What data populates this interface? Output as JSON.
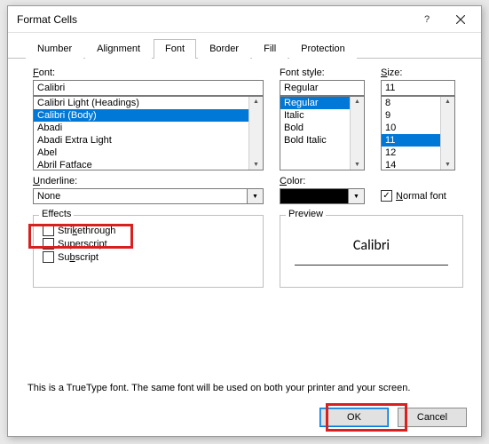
{
  "title": "Format Cells",
  "tabs": [
    "Number",
    "Alignment",
    "Font",
    "Border",
    "Fill",
    "Protection"
  ],
  "active_tab": "Font",
  "font": {
    "label": "Font:",
    "value": "Calibri",
    "items": [
      "Calibri Light (Headings)",
      "Calibri (Body)",
      "Abadi",
      "Abadi Extra Light",
      "Abel",
      "Abril Fatface"
    ],
    "selected": "Calibri (Body)"
  },
  "font_style": {
    "label": "Font style:",
    "value": "Regular",
    "items": [
      "Regular",
      "Italic",
      "Bold",
      "Bold Italic"
    ],
    "selected": "Regular"
  },
  "size": {
    "label": "Size:",
    "value": "11",
    "items": [
      "8",
      "9",
      "10",
      "11",
      "12",
      "14"
    ],
    "selected": "11"
  },
  "underline": {
    "label": "Underline:",
    "value": "None"
  },
  "color": {
    "label": "Color:",
    "value": "#000000"
  },
  "normal_font": {
    "label": "Normal font",
    "checked": true
  },
  "effects": {
    "legend": "Effects",
    "strikethrough": "Strikethrough",
    "superscript": "Superscript",
    "subscript": "Subscript"
  },
  "preview": {
    "legend": "Preview",
    "sample": "Calibri"
  },
  "hint": "This is a TrueType font.  The same font will be used on both your printer and your screen.",
  "buttons": {
    "ok": "OK",
    "cancel": "Cancel"
  }
}
